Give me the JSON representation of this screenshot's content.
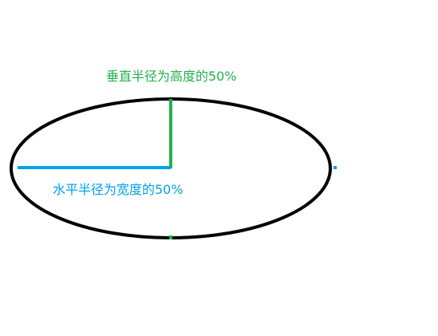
{
  "labels": {
    "vertical_radius": "垂直半径为高度的50%",
    "horizontal_radius": "水平半径为宽度的50%"
  },
  "colors": {
    "background": "#ffffff",
    "ellipse_outline": "#000000",
    "vertical_radius": "#22b14c",
    "horizontal_radius": "#00a2e8"
  }
}
